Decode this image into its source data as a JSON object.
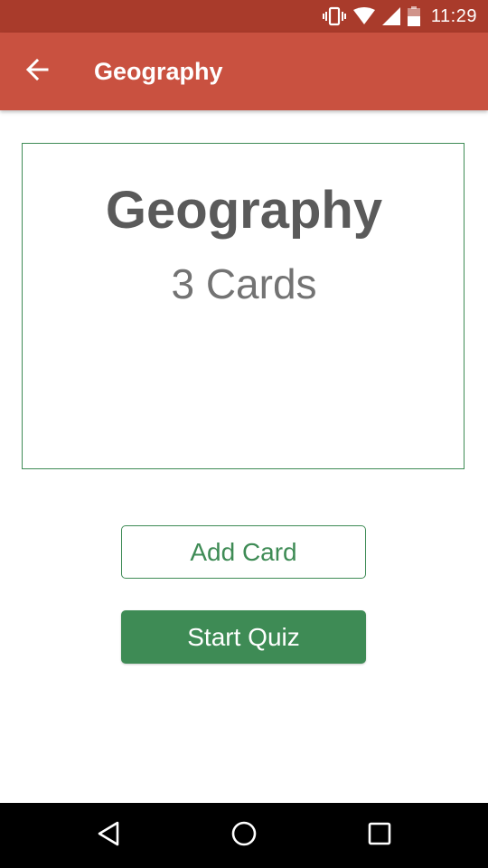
{
  "status_bar": {
    "time": "11:29",
    "icons": [
      "vibrate-icon",
      "wifi-icon",
      "cell-signal-icon",
      "battery-icon"
    ]
  },
  "app_bar": {
    "title": "Geography",
    "back_icon": "arrow-back-icon"
  },
  "deck": {
    "title": "Geography",
    "count_label": "3 Cards"
  },
  "actions": {
    "add_card_label": "Add Card",
    "start_quiz_label": "Start Quiz"
  },
  "nav_bar": {
    "icons": [
      "back-triangle-icon",
      "home-circle-icon",
      "recents-square-icon"
    ]
  },
  "colors": {
    "status_bar": "#a93b2b",
    "app_bar": "#c95140",
    "accent_green": "#3e8b55",
    "title_text": "#5a5a5a",
    "count_text": "#737373"
  }
}
